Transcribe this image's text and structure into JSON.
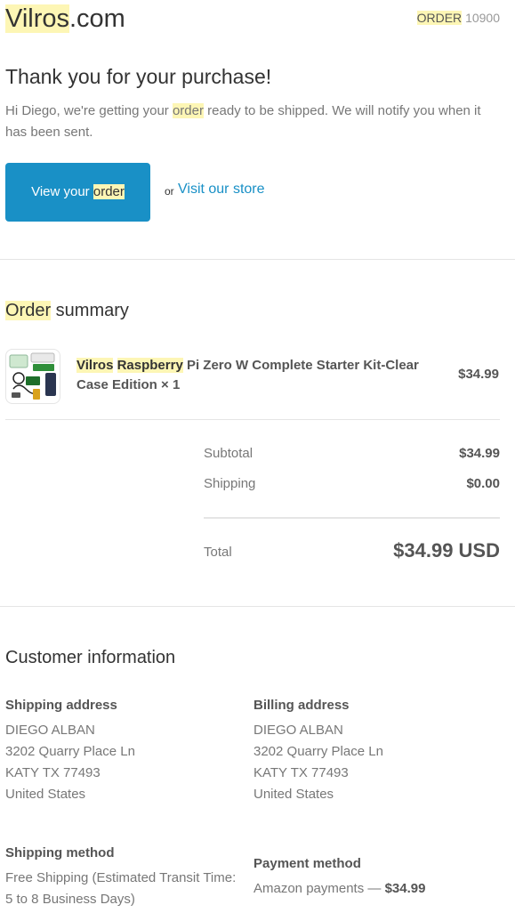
{
  "header": {
    "brand_highlight": "Vilros",
    "brand_suffix": ".com",
    "order_label": "ORDER",
    "order_number": "10900"
  },
  "confirmation": {
    "title": "Thank you for your purchase!",
    "intro_before": "Hi Diego, we're getting your ",
    "intro_highlight": "order",
    "intro_after": " ready to be shipped. We will notify you when it has been sent.",
    "button_text": "View your ",
    "button_highlight": "order",
    "or_text": "or",
    "store_link": "Visit our store"
  },
  "order_summary": {
    "title_highlight": "Order",
    "title_rest": " summary",
    "items": [
      {
        "name_hl1": "Vilros",
        "name_hl2": "Raspberry",
        "name_rest": " Pi Zero W Complete Starter Kit-Clear Case Edition × 1",
        "price": "$34.99"
      }
    ],
    "subtotal_label": "Subtotal",
    "subtotal_value": "$34.99",
    "shipping_label": "Shipping",
    "shipping_value": "$0.00",
    "total_label": "Total",
    "total_value": "$34.99 USD"
  },
  "customer": {
    "title": "Customer information",
    "shipping_address": {
      "heading": "Shipping address",
      "lines": [
        "DIEGO ALBAN",
        "3202 Quarry Place Ln",
        "KATY TX 77493",
        "United States"
      ]
    },
    "billing_address": {
      "heading": "Billing address",
      "lines": [
        "DIEGO ALBAN",
        "3202 Quarry Place Ln",
        "KATY TX 77493",
        "United States"
      ]
    },
    "shipping_method": {
      "heading": "Shipping method",
      "lines": [
        "Free Shipping (Estimated Transit Time:",
        "5 to 8 Business Days)"
      ]
    },
    "payment_method": {
      "heading": "Payment method",
      "method": "Amazon payments — ",
      "amount": "$34.99"
    }
  },
  "colors": {
    "accent": "#1990c6",
    "highlight": "#fdf6b5"
  }
}
